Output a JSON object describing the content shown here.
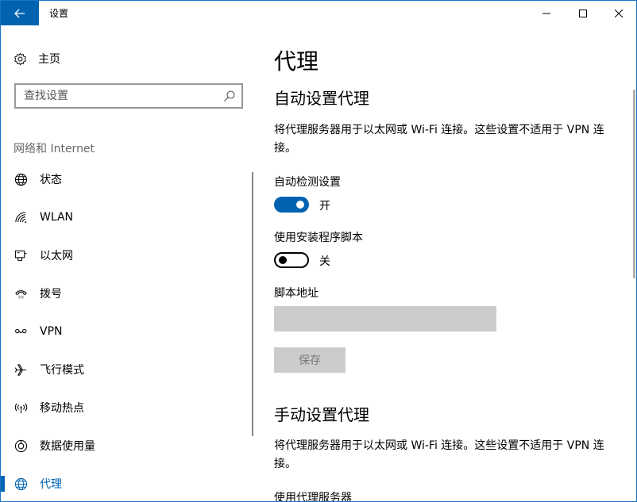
{
  "window": {
    "title": "设置"
  },
  "sidebar": {
    "home_label": "主页",
    "search": {
      "placeholder": "查找设置"
    },
    "section_title": "网络和 Internet",
    "items": [
      {
        "label": "状态",
        "icon": "globe-status-icon"
      },
      {
        "label": "WLAN",
        "icon": "wifi-icon"
      },
      {
        "label": "以太网",
        "icon": "ethernet-icon"
      },
      {
        "label": "拨号",
        "icon": "dialup-icon"
      },
      {
        "label": "VPN",
        "icon": "vpn-icon"
      },
      {
        "label": "飞行模式",
        "icon": "airplane-icon"
      },
      {
        "label": "移动热点",
        "icon": "hotspot-icon"
      },
      {
        "label": "数据使用量",
        "icon": "data-usage-icon"
      },
      {
        "label": "代理",
        "icon": "globe-icon",
        "active": true
      }
    ]
  },
  "main": {
    "page_title": "代理",
    "auto": {
      "heading": "自动设置代理",
      "description": "将代理服务器用于以太网或 Wi-Fi 连接。这些设置不适用于 VPN 连接。",
      "detect": {
        "label": "自动检测设置",
        "state": "开",
        "on": true
      },
      "script": {
        "label": "使用安装程序脚本",
        "state": "关",
        "on": false
      },
      "script_address_label": "脚本地址",
      "script_address_value": "",
      "save_label": "保存"
    },
    "manual": {
      "heading": "手动设置代理",
      "description": "将代理服务器用于以太网或 Wi-Fi 连接。这些设置不适用于 VPN 连接。",
      "use_proxy_label": "使用代理服务器"
    }
  },
  "colors": {
    "accent": "#0063b1",
    "disabled_bg": "#cccccc"
  }
}
